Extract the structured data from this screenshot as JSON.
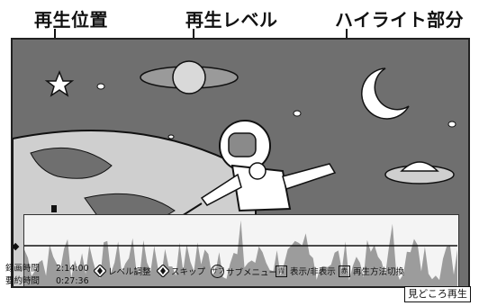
{
  "callouts": {
    "playback_position": "再生位置",
    "playback_level": "再生レベル",
    "highlight_part": "ハイライト部分"
  },
  "info": {
    "record_time_label": "録画時間",
    "record_time_value": "2:14:00",
    "summary_time_label": "要約時間",
    "summary_time_value": "0:27:36"
  },
  "guide": {
    "level_adjust": "レベル調整",
    "skip": "スキップ",
    "submenu_key": "サブ",
    "submenu": "サブメニュー",
    "blue_key": "青",
    "show_hide": "表示/非表示",
    "red_key": "赤",
    "playback_mode_switch": "再生方法切換",
    "highlight_playback": "見どころ再生"
  },
  "icons": {
    "dpad": "dpad-icon",
    "level_arrow": "level-adjust-arrow-icon"
  }
}
